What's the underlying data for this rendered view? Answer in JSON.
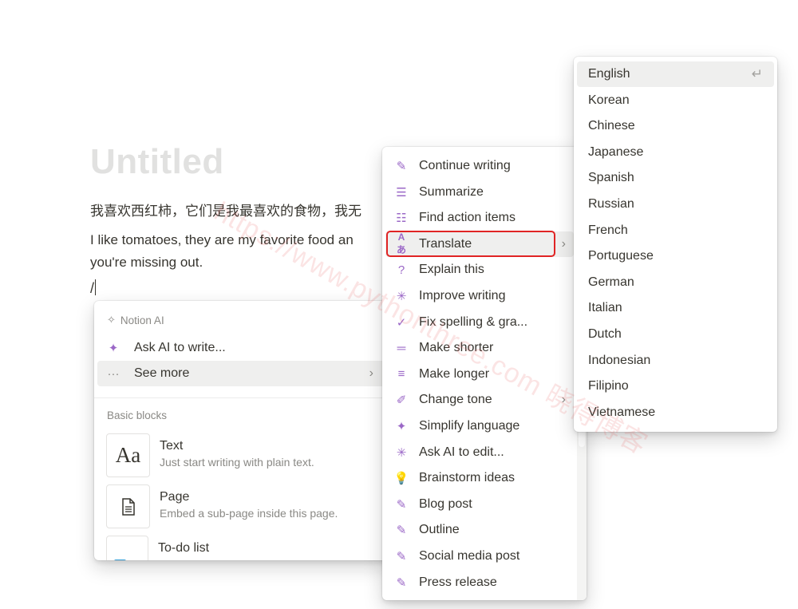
{
  "page": {
    "title": "Untitled",
    "paragraph_zh": "我喜欢西红柿，它们是我最喜欢的食物，我无",
    "paragraph_en_line1": "I like tomatoes, they are my favorite food an",
    "paragraph_en_line2": "you're missing out.",
    "slash_input": "/"
  },
  "slash_menu": {
    "ai_section_label": "Notion AI",
    "ask_ai_label": "Ask AI to write...",
    "see_more_label": "See more",
    "basic_blocks_label": "Basic blocks",
    "blocks": [
      {
        "title": "Text",
        "description": "Just start writing with plain text.",
        "thumb": "Aa"
      },
      {
        "title": "Page",
        "description": "Embed a sub-page inside this page."
      },
      {
        "title": "To-do list",
        "description": ""
      }
    ]
  },
  "ai_menu": {
    "items": [
      {
        "label": "Continue writing",
        "icon": "pen-icon",
        "glyph": "✎"
      },
      {
        "label": "Summarize",
        "icon": "summarize-icon",
        "glyph": "☰"
      },
      {
        "label": "Find action items",
        "icon": "list-icon",
        "glyph": "☷"
      },
      {
        "label": "Translate",
        "icon": "translate-icon",
        "glyph": "Aあ"
      },
      {
        "label": "Explain this",
        "icon": "question-icon",
        "glyph": "?"
      },
      {
        "label": "Improve writing",
        "icon": "sparkle-burst-icon",
        "glyph": "✳"
      },
      {
        "label": "Fix spelling & gra...",
        "icon": "check-icon",
        "glyph": "✓"
      },
      {
        "label": "Make shorter",
        "icon": "short-lines-icon",
        "glyph": "═"
      },
      {
        "label": "Make longer",
        "icon": "long-lines-icon",
        "glyph": "≡"
      },
      {
        "label": "Change tone",
        "icon": "pencil-icon",
        "glyph": "✐"
      },
      {
        "label": "Simplify language",
        "icon": "sparkle-icon",
        "glyph": "✦"
      },
      {
        "label": "Ask AI to edit...",
        "icon": "sparkle-burst-icon",
        "glyph": "✳"
      },
      {
        "label": "Brainstorm ideas",
        "icon": "lightbulb-icon",
        "glyph": "💡"
      },
      {
        "label": "Blog post",
        "icon": "pen-icon",
        "glyph": "✎"
      },
      {
        "label": "Outline",
        "icon": "pen-icon",
        "glyph": "✎"
      },
      {
        "label": "Social media post",
        "icon": "pen-icon",
        "glyph": "✎"
      },
      {
        "label": "Press release",
        "icon": "pen-icon",
        "glyph": "✎"
      }
    ]
  },
  "languages": [
    "English",
    "Korean",
    "Chinese",
    "Japanese",
    "Spanish",
    "Russian",
    "French",
    "Portuguese",
    "German",
    "Italian",
    "Dutch",
    "Indonesian",
    "Filipino",
    "Vietnamese"
  ],
  "watermark": "https://www.pythonthree.com 晓得博客",
  "colors": {
    "accent": "#9b68c7",
    "highlight_border": "#e02424",
    "hover_bg": "#efefee"
  }
}
